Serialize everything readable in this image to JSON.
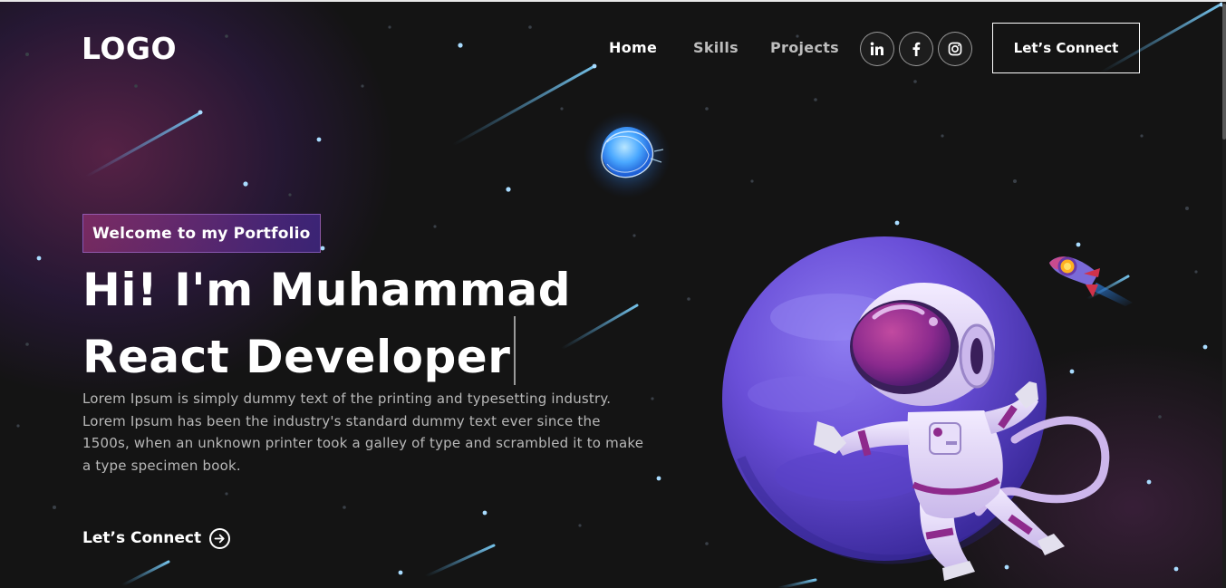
{
  "nav": {
    "logo": "LOGO",
    "links": [
      {
        "label": "Home",
        "active": true
      },
      {
        "label": "Skills",
        "active": false
      },
      {
        "label": "Projects",
        "active": false
      }
    ],
    "social": [
      {
        "name": "linkedin",
        "icon": "linkedin-icon"
      },
      {
        "name": "facebook",
        "icon": "facebook-icon"
      },
      {
        "name": "instagram",
        "icon": "instagram-icon"
      }
    ],
    "connect_button": "Let’s Connect"
  },
  "hero": {
    "tagline": "Welcome to my Portfolio",
    "headline_line1": "Hi! I'm Muhammad",
    "headline_line2": "React Developer",
    "description": "Lorem Ipsum is simply dummy text of the printing and typesetting industry. Lorem Ipsum has been the industry's standard dummy text ever since the 1500s, when an unknown printer took a galley of type and scrambled it to make a type specimen book.",
    "cta_label": "Let’s Connect",
    "cta_icon": "arrow-right-circle-icon"
  },
  "colors": {
    "background": "#121212",
    "accent_pink": "#AA367C",
    "accent_purple": "#4A2FBD",
    "planet": "#6a4fd8",
    "star": "#9fd8ff"
  }
}
